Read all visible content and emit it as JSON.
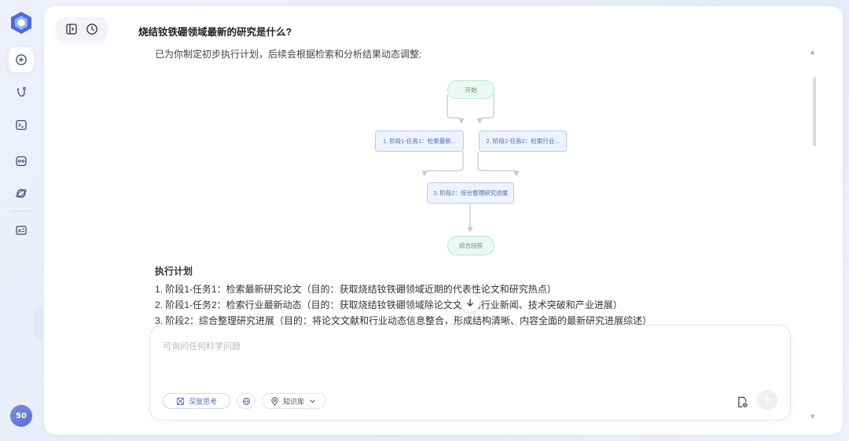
{
  "sidebar": {
    "avatar_text": "50",
    "items": [
      {
        "icon": "new-chat-icon"
      },
      {
        "icon": "agent-icon"
      },
      {
        "icon": "terminal-icon"
      },
      {
        "icon": "model-icon"
      },
      {
        "icon": "planet-icon"
      },
      {
        "icon": "id-card-icon"
      }
    ]
  },
  "conversation": {
    "question": "烧结钕铁硼领域最新的研究是什么?",
    "intro": "已为你制定初步执行计划，后续会根据检索和分析结果动态调整:"
  },
  "flow": {
    "start": "开始",
    "task1": "1. 阶段1-任务1：检索最新...",
    "task2": "2. 阶段1-任务2：检索行业...",
    "task3": "3. 阶段2：综合整理研究进展",
    "end": "综合回答"
  },
  "plan": {
    "title": "执行计划",
    "items": [
      "1. 阶段1-任务1：检索最新研究论文（目的：获取烧结钕铁硼领域近期的代表性论文和研究热点）",
      "2. 阶段1-任务2：检索行业最新动态（目的：获取烧结钕铁硼领域除论文文外的行业新闻、技术突破和产业进展）",
      "3. 阶段2：综合整理研究进展（目的：将论文文献和行业动态信息整合，形成结构清晰、内容全面的最新研究进展综述）"
    ]
  },
  "input": {
    "placeholder": "可询问任何科学问题",
    "deep_think_label": "深度思考",
    "knowledge_base_label": "知识库"
  },
  "colors": {
    "accent": "#5b6fd0",
    "node_green_bg": "#eafaf3",
    "node_blue_bg": "#eef4ff"
  }
}
